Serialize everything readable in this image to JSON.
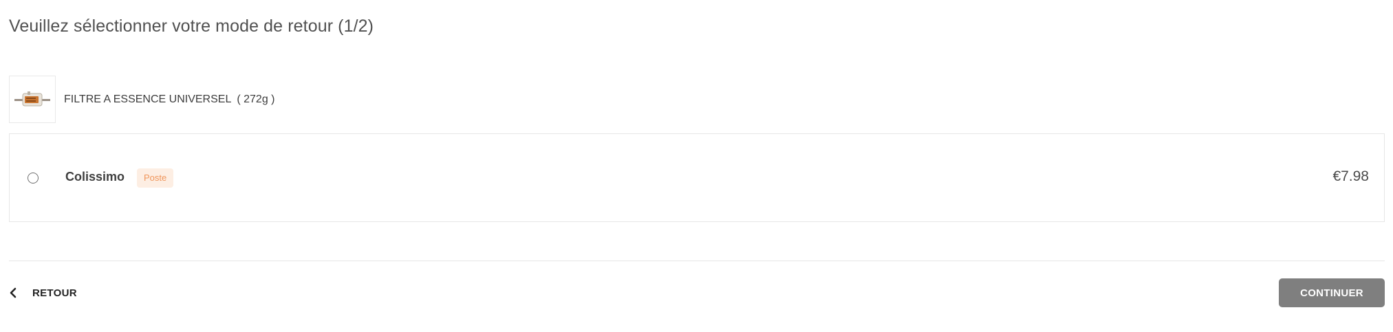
{
  "page": {
    "title": "Veuillez sélectionner votre mode de retour (1/2)"
  },
  "product": {
    "name": "FILTRE A ESSENCE UNIVERSEL",
    "weight": "( 272g )",
    "image_icon": "fuel-filter-image"
  },
  "shipping_option": {
    "carrier": "Colissimo",
    "badge": "Poste",
    "price": "€7.98",
    "selected": false
  },
  "footer": {
    "back_label": "RETOUR",
    "continue_label": "CONTINUER"
  },
  "colors": {
    "badge_background": "#fdeee3",
    "badge_text": "#f0955a",
    "continue_background": "#7f7f7f"
  }
}
